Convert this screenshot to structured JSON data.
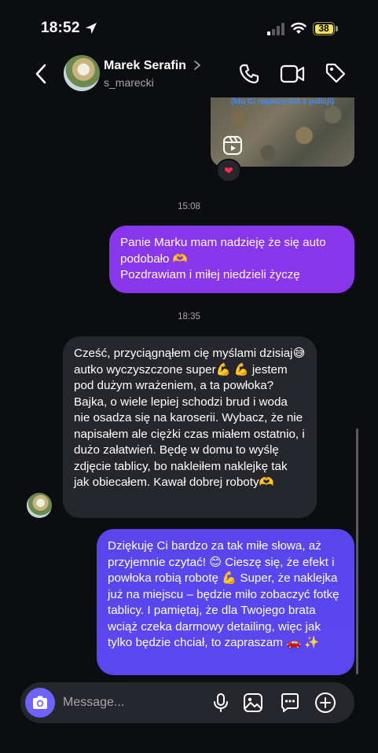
{
  "status_bar": {
    "time": "18:52",
    "battery": "38"
  },
  "header": {
    "name": "Marek Serafin",
    "handle": "s_marecki"
  },
  "media": {
    "caption": "(kto Ci napisze ten z policji)",
    "reaction": "❤"
  },
  "messages": [
    {
      "type": "timestamp",
      "text": "15:08"
    },
    {
      "type": "outgoing",
      "text": "Panie Marku mam nadzieję że się auto podobało 🫶\nPozdrawiam i miłej niedzieli życzę"
    },
    {
      "type": "timestamp",
      "text": "18:35"
    },
    {
      "type": "incoming",
      "text": "Cześć, przyciągnąłem cię myślami dzisiaj😅 autko wyczyszczone super💪 💪 jestem pod dużym wrażeniem, a ta powłoka? Bajka, o wiele lepiej schodzi brud i woda nie osadza się na karoserii. Wybacz, że nie napisałem ale ciężki czas miałem ostatnio, i dużo załatwień. Będę w domu to wyślę zdjęcie tablicy, bo nakleiłem naklejkę tak jak obiecałem. Kawał dobrej roboty🫶"
    },
    {
      "type": "outgoing",
      "text": "Dziękuję Ci bardzo za tak miłe słowa, aż przyjemnie czytać! 😊 Cieszę się, że efekt i powłoka robią robotę 💪 Super, że naklejka już na miejscu – będzie miło zobaczyć fotkę tablicy. I pamiętaj, że dla Twojego brata wciąż czeka darmowy detailing, więc jak tylko będzie chciał, to zapraszam 🚗 ✨"
    }
  ],
  "composer": {
    "placeholder": "Message..."
  },
  "colors": {
    "outgoing_top": "#8a36ec",
    "outgoing_bottom": "#5a45ec",
    "incoming": "#26272c",
    "accent": "#6e63ff",
    "background": "#0c0d10"
  }
}
